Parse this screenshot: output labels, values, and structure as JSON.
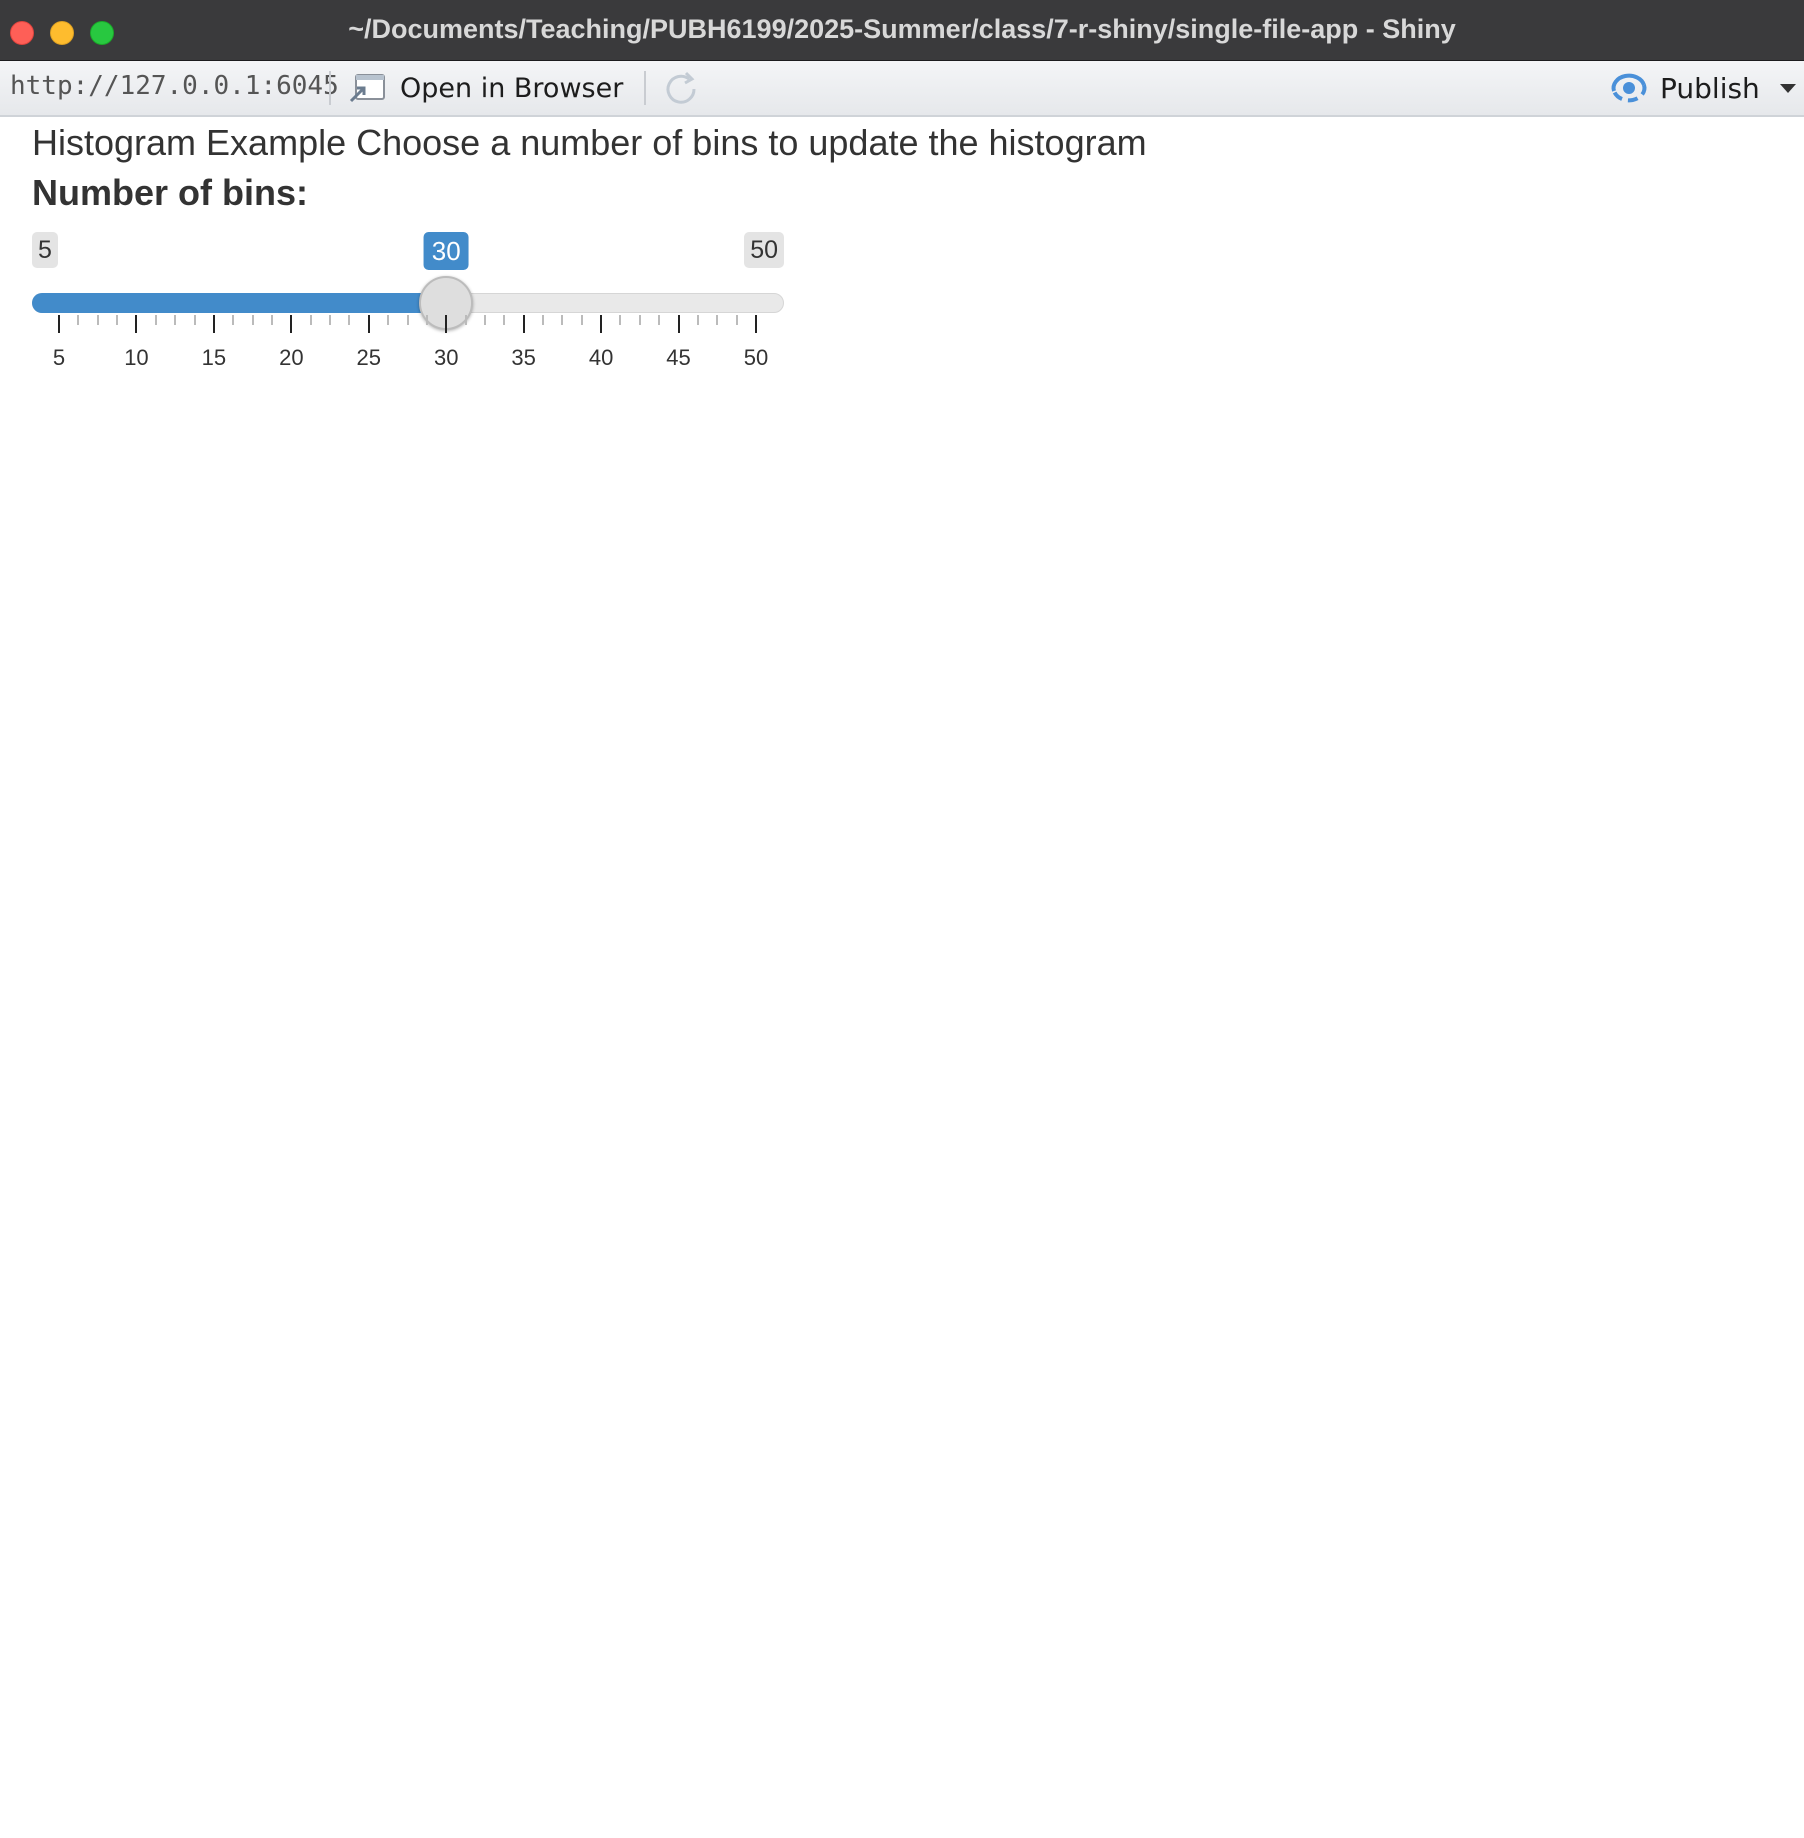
{
  "window": {
    "title": "~/Documents/Teaching/PUBH6199/2025-Summer/class/7-r-shiny/single-file-app - Shiny"
  },
  "toolbar": {
    "url": "http://127.0.0.1:6045",
    "open_in_browser_label": "Open in Browser",
    "publish_label": "Publish",
    "icons": {
      "open_in_browser": "open-in-browser-icon",
      "refresh": "refresh-icon",
      "publish": "publish-icon"
    }
  },
  "app": {
    "heading": "Histogram Example Choose a number of bins to update the histogram",
    "slider": {
      "label": "Number of bins:",
      "min": 5,
      "max": 50,
      "value": 30,
      "min_label": "5",
      "max_label": "50",
      "value_label": "30",
      "tick_labels": [
        "5",
        "10",
        "15",
        "20",
        "25",
        "30",
        "35",
        "40",
        "45",
        "50"
      ],
      "accent_color": "#428bca"
    }
  }
}
